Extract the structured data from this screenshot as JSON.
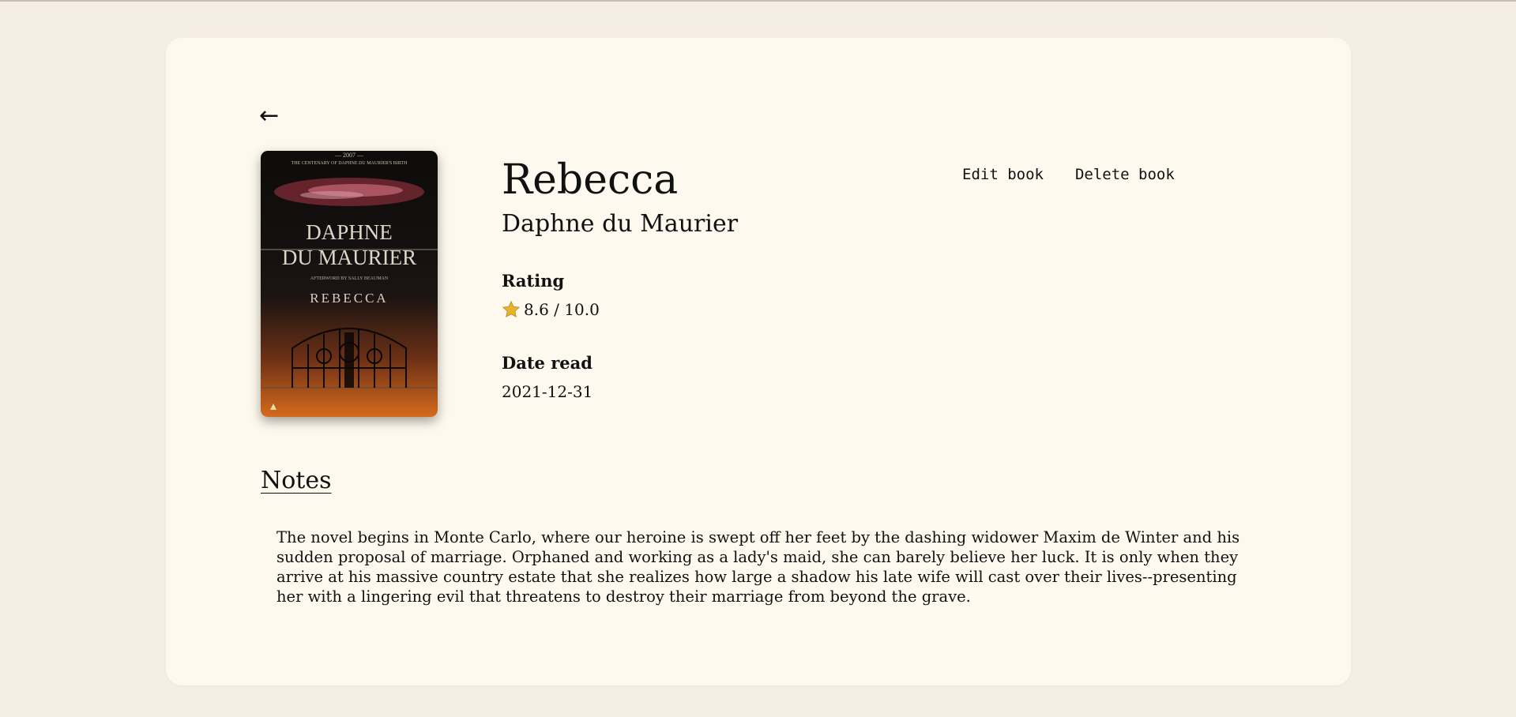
{
  "nav": {
    "back_icon_glyph": "←"
  },
  "book": {
    "title": "Rebecca",
    "author": "Daphne du Maurier",
    "cover": {
      "top_line1": "— 2007 —",
      "top_line2": "THE CENTENARY OF DAPHNE DU MAURIER'S BIRTH",
      "author_line1": "DAPHNE",
      "author_line2": "DU MAURIER",
      "subtitle": "AFTERWORD BY SALLY BEAUMAN",
      "title": "REBECCA"
    }
  },
  "actions": {
    "edit_label": "Edit book",
    "delete_label": "Delete book"
  },
  "rating": {
    "label": "Rating",
    "value": "8.6 / 10.0",
    "icon": "star-icon",
    "icon_color": "#e7b52c"
  },
  "date_read": {
    "label": "Date read",
    "value": "2021-12-31"
  },
  "notes": {
    "heading": "Notes",
    "text": "The novel begins in Monte Carlo, where our heroine is swept off her feet by the dashing widower Maxim de Winter and his sudden proposal of marriage. Orphaned and working as a lady's maid, she can barely believe her luck. It is only when they arrive at his massive country estate that she realizes how large a shadow his late wife will cast over their lives--presenting her with a lingering evil that threatens to destroy their marriage from beyond the grave."
  },
  "colors": {
    "page_bg": "#f5eee3",
    "card_bg": "#fdf9ee",
    "text": "#111111"
  }
}
